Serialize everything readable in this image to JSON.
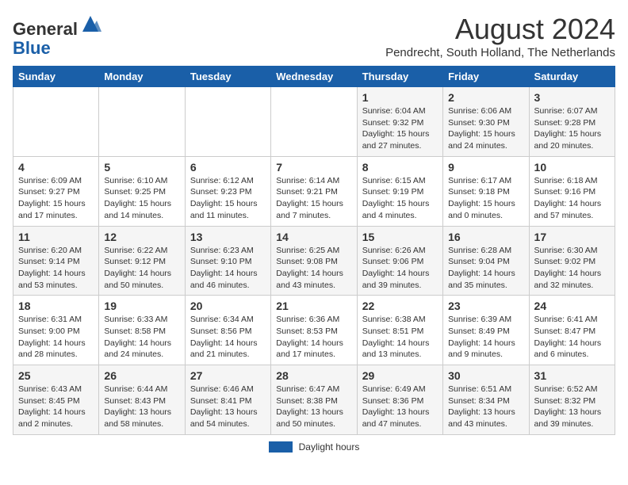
{
  "header": {
    "logo_general": "General",
    "logo_blue": "Blue",
    "month_title": "August 2024",
    "location": "Pendrecht, South Holland, The Netherlands"
  },
  "days_of_week": [
    "Sunday",
    "Monday",
    "Tuesday",
    "Wednesday",
    "Thursday",
    "Friday",
    "Saturday"
  ],
  "weeks": [
    [
      {
        "num": "",
        "info": ""
      },
      {
        "num": "",
        "info": ""
      },
      {
        "num": "",
        "info": ""
      },
      {
        "num": "",
        "info": ""
      },
      {
        "num": "1",
        "info": "Sunrise: 6:04 AM\nSunset: 9:32 PM\nDaylight: 15 hours and 27 minutes."
      },
      {
        "num": "2",
        "info": "Sunrise: 6:06 AM\nSunset: 9:30 PM\nDaylight: 15 hours and 24 minutes."
      },
      {
        "num": "3",
        "info": "Sunrise: 6:07 AM\nSunset: 9:28 PM\nDaylight: 15 hours and 20 minutes."
      }
    ],
    [
      {
        "num": "4",
        "info": "Sunrise: 6:09 AM\nSunset: 9:27 PM\nDaylight: 15 hours and 17 minutes."
      },
      {
        "num": "5",
        "info": "Sunrise: 6:10 AM\nSunset: 9:25 PM\nDaylight: 15 hours and 14 minutes."
      },
      {
        "num": "6",
        "info": "Sunrise: 6:12 AM\nSunset: 9:23 PM\nDaylight: 15 hours and 11 minutes."
      },
      {
        "num": "7",
        "info": "Sunrise: 6:14 AM\nSunset: 9:21 PM\nDaylight: 15 hours and 7 minutes."
      },
      {
        "num": "8",
        "info": "Sunrise: 6:15 AM\nSunset: 9:19 PM\nDaylight: 15 hours and 4 minutes."
      },
      {
        "num": "9",
        "info": "Sunrise: 6:17 AM\nSunset: 9:18 PM\nDaylight: 15 hours and 0 minutes."
      },
      {
        "num": "10",
        "info": "Sunrise: 6:18 AM\nSunset: 9:16 PM\nDaylight: 14 hours and 57 minutes."
      }
    ],
    [
      {
        "num": "11",
        "info": "Sunrise: 6:20 AM\nSunset: 9:14 PM\nDaylight: 14 hours and 53 minutes."
      },
      {
        "num": "12",
        "info": "Sunrise: 6:22 AM\nSunset: 9:12 PM\nDaylight: 14 hours and 50 minutes."
      },
      {
        "num": "13",
        "info": "Sunrise: 6:23 AM\nSunset: 9:10 PM\nDaylight: 14 hours and 46 minutes."
      },
      {
        "num": "14",
        "info": "Sunrise: 6:25 AM\nSunset: 9:08 PM\nDaylight: 14 hours and 43 minutes."
      },
      {
        "num": "15",
        "info": "Sunrise: 6:26 AM\nSunset: 9:06 PM\nDaylight: 14 hours and 39 minutes."
      },
      {
        "num": "16",
        "info": "Sunrise: 6:28 AM\nSunset: 9:04 PM\nDaylight: 14 hours and 35 minutes."
      },
      {
        "num": "17",
        "info": "Sunrise: 6:30 AM\nSunset: 9:02 PM\nDaylight: 14 hours and 32 minutes."
      }
    ],
    [
      {
        "num": "18",
        "info": "Sunrise: 6:31 AM\nSunset: 9:00 PM\nDaylight: 14 hours and 28 minutes."
      },
      {
        "num": "19",
        "info": "Sunrise: 6:33 AM\nSunset: 8:58 PM\nDaylight: 14 hours and 24 minutes."
      },
      {
        "num": "20",
        "info": "Sunrise: 6:34 AM\nSunset: 8:56 PM\nDaylight: 14 hours and 21 minutes."
      },
      {
        "num": "21",
        "info": "Sunrise: 6:36 AM\nSunset: 8:53 PM\nDaylight: 14 hours and 17 minutes."
      },
      {
        "num": "22",
        "info": "Sunrise: 6:38 AM\nSunset: 8:51 PM\nDaylight: 14 hours and 13 minutes."
      },
      {
        "num": "23",
        "info": "Sunrise: 6:39 AM\nSunset: 8:49 PM\nDaylight: 14 hours and 9 minutes."
      },
      {
        "num": "24",
        "info": "Sunrise: 6:41 AM\nSunset: 8:47 PM\nDaylight: 14 hours and 6 minutes."
      }
    ],
    [
      {
        "num": "25",
        "info": "Sunrise: 6:43 AM\nSunset: 8:45 PM\nDaylight: 14 hours and 2 minutes."
      },
      {
        "num": "26",
        "info": "Sunrise: 6:44 AM\nSunset: 8:43 PM\nDaylight: 13 hours and 58 minutes."
      },
      {
        "num": "27",
        "info": "Sunrise: 6:46 AM\nSunset: 8:41 PM\nDaylight: 13 hours and 54 minutes."
      },
      {
        "num": "28",
        "info": "Sunrise: 6:47 AM\nSunset: 8:38 PM\nDaylight: 13 hours and 50 minutes."
      },
      {
        "num": "29",
        "info": "Sunrise: 6:49 AM\nSunset: 8:36 PM\nDaylight: 13 hours and 47 minutes."
      },
      {
        "num": "30",
        "info": "Sunrise: 6:51 AM\nSunset: 8:34 PM\nDaylight: 13 hours and 43 minutes."
      },
      {
        "num": "31",
        "info": "Sunrise: 6:52 AM\nSunset: 8:32 PM\nDaylight: 13 hours and 39 minutes."
      }
    ]
  ],
  "legend": {
    "label": "Daylight hours"
  }
}
